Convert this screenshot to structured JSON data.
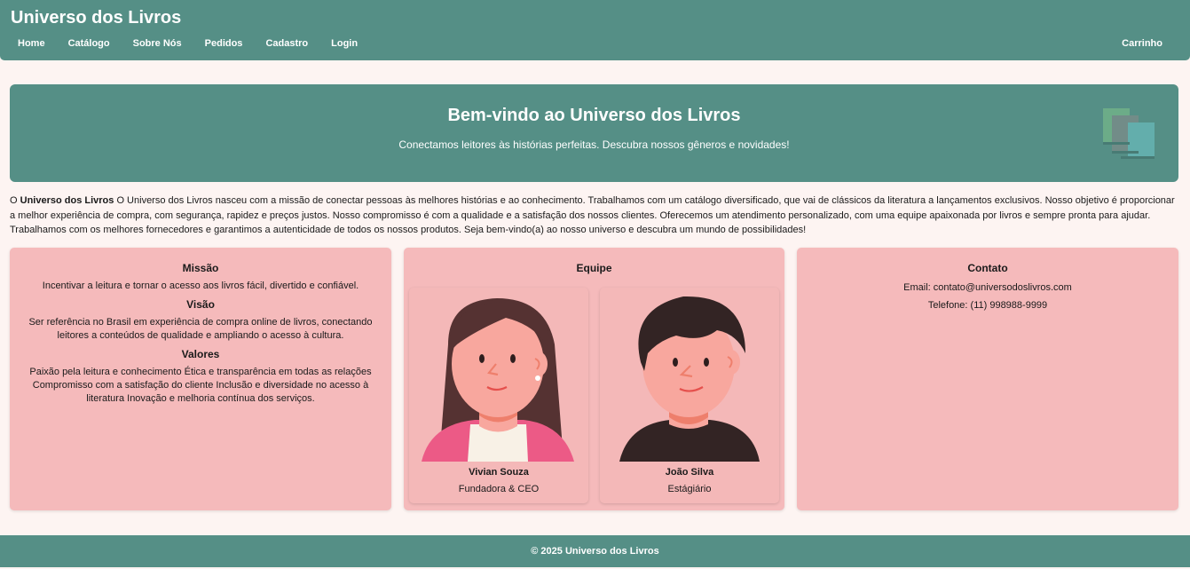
{
  "header": {
    "brand": "Universo dos Livros",
    "nav": [
      "Home",
      "Catálogo",
      "Sobre Nós",
      "Pedidos",
      "Cadastro",
      "Login"
    ],
    "cart": "Carrinho"
  },
  "hero": {
    "title": "Bem-vindo ao Universo dos Livros",
    "subtitle": "Conectamos leitores às histórias perfeitas. Descubra nossos gêneros e novidades!",
    "icon": "books-icon"
  },
  "about": {
    "prefix": "O ",
    "brand": "Universo dos Livros",
    "text": " O Universo dos Livros nasceu com a missão de conectar pessoas às melhores histórias e ao conhecimento. Trabalhamos com um catálogo diversificado, que vai de clássicos da literatura a lançamentos exclusivos. Nosso objetivo é proporcionar a melhor experiência de compra, com segurança, rapidez e preços justos. Nosso compromisso é com a qualidade e a satisfação dos nossos clientes. Oferecemos um atendimento personalizado, com uma equipe apaixonada por livros e sempre pronta para ajudar. Trabalhamos com os melhores fornecedores e garantimos a autenticidade de todos os nossos produtos. Seja bem-vindo(a) ao nosso universo e descubra um mundo de possibilidades!"
  },
  "mission": {
    "mission_title": "Missão",
    "mission_text": "Incentivar a leitura e tornar o acesso aos livros fácil, divertido e confiável.",
    "vision_title": "Visão",
    "vision_text": "Ser referência no Brasil em experiência de compra online de livros, conectando leitores a conteúdos de qualidade e ampliando o acesso à cultura.",
    "values_title": "Valores",
    "values_text": "Paixão pela leitura e conhecimento Ética e transparência em todas as relações Compromisso com a satisfação do cliente Inclusão e diversidade no acesso à literatura Inovação e melhoria contínua dos serviços."
  },
  "team": {
    "title": "Equipe",
    "members": [
      {
        "name": "Vivian Souza",
        "role": "Fundadora & CEO"
      },
      {
        "name": "João Silva",
        "role": "Estágiário"
      }
    ]
  },
  "contact": {
    "title": "Contato",
    "email": "Email: contato@universodoslivros.com",
    "phone": "Telefone: (11) 998988-9999"
  },
  "footer": {
    "text": "© 2025 Universo dos Livros"
  },
  "colors": {
    "primary": "#558f86",
    "card": "#f5babb",
    "background": "#fdf4f2"
  }
}
